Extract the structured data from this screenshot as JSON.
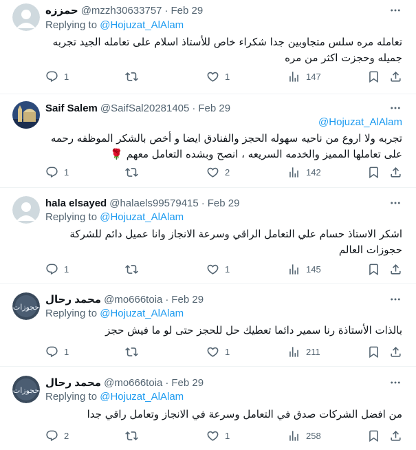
{
  "tweets": [
    {
      "name": "حمززه",
      "handle": "@mzzh30633757",
      "date": "Feb 29",
      "replying_label": "Replying to",
      "replying_to": "@Hojuzat_AlAlam",
      "text": "تعامله مره سلس متجاوبين جدا شكراء خاص للأستاذ اسلام على تعامله الجيد تجربه جميله وحجزت اكثر من مره",
      "replies": "1",
      "retweets": "",
      "likes": "1",
      "views": "147"
    },
    {
      "name": "Saif Salem",
      "handle": "@SaifSal20281405",
      "date": "Feb 29",
      "mention": "@Hojuzat_AlAlam",
      "text": "تجربه ولا اروع من ناحيه سهوله الحجز والفنادق ايضا و أخص بالشكر الموظفه رحمه على تعاملها المميز والخدمه السريعه ، انصح وبشده التعامل معهم 🌹",
      "replies": "1",
      "retweets": "",
      "likes": "2",
      "views": "142"
    },
    {
      "name": "hala elsayed",
      "handle": "@halaels99579415",
      "date": "Feb 29",
      "replying_label": "Replying to",
      "replying_to": "@Hojuzat_AlAlam",
      "text": "اشكر الاستاذ حسام علي التعامل الراقي وسرعة الانجاز وانا عميل دائم للشركة حجوزات العالم",
      "replies": "1",
      "retweets": "",
      "likes": "1",
      "views": "145"
    },
    {
      "name": "محمد رحال",
      "handle": "@mo666toia",
      "date": "Feb 29",
      "replying_label": "Replying to",
      "replying_to": "@Hojuzat_AlAlam",
      "text": "بالذات الأستاذة رنا سمير دائما تعطيك حل للحجز حتى لو ما فيش حجز",
      "replies": "1",
      "retweets": "",
      "likes": "1",
      "views": "211"
    },
    {
      "name": "محمد رحال",
      "handle": "@mo666toia",
      "date": "Feb 29",
      "replying_label": "Replying to",
      "replying_to": "@Hojuzat_AlAlam",
      "text": "من افضل الشركات صدق في التعامل وسرعة في الانجاز وتعامل راقي جدا",
      "replies": "2",
      "retweets": "",
      "likes": "1",
      "views": "258"
    }
  ],
  "avatar_watermark": "حجوزات",
  "colors": {
    "text": "#0f1419",
    "secondary": "#536471",
    "link": "#1d9bf0",
    "divider": "#eff3f4"
  },
  "icons": {
    "more": "more-icon",
    "reply": "reply-icon",
    "retweet": "retweet-icon",
    "like": "like-icon",
    "views": "views-icon",
    "bookmark": "bookmark-icon",
    "share": "share-icon"
  }
}
